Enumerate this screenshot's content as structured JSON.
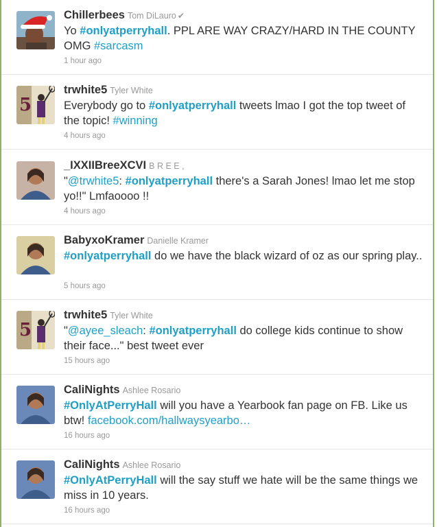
{
  "tweets": [
    {
      "screen_name": "Chillerbees",
      "full_name": "Tom DiLauro",
      "verified_mark": "✔",
      "avatar": "avatar-santa-hat-icon",
      "segments": [
        {
          "type": "text",
          "text": "Yo "
        },
        {
          "type": "tag",
          "text": "#onlyatperryhall"
        },
        {
          "type": "text",
          "text": ". PPL ARE WAY CRAZY/HARD IN THE COUNTY OMG "
        },
        {
          "type": "tag_plain",
          "text": "#sarcasm"
        }
      ],
      "time": "1 hour ago"
    },
    {
      "screen_name": "trwhite5",
      "full_name": "Tyler White",
      "avatar": "avatar-lacrosse-icon",
      "segments": [
        {
          "type": "text",
          "text": "Everybody go to "
        },
        {
          "type": "tag",
          "text": "#onlyatperryhall"
        },
        {
          "type": "text",
          "text": " tweets lmao I got the top tweet of the topic! "
        },
        {
          "type": "tag_plain",
          "text": "#winning"
        }
      ],
      "time": "4 hours ago"
    },
    {
      "screen_name": "_IXXIIBreeXCVI",
      "full_name": "B R E E ,",
      "avatar": "avatar-portrait-icon",
      "segments": [
        {
          "type": "text",
          "text": "\""
        },
        {
          "type": "mention",
          "text": "@trwhite5"
        },
        {
          "type": "text",
          "text": ": "
        },
        {
          "type": "tag",
          "text": "#onlyatperryhall"
        },
        {
          "type": "text",
          "text": " there's a Sarah Jones! lmao let me stop yo!!\" Lmfaoooo !!"
        }
      ],
      "time": "4 hours ago"
    },
    {
      "screen_name": "BabyxoKramer",
      "full_name": "Danielle Kramer",
      "avatar": "avatar-portrait-icon",
      "segments": [
        {
          "type": "tag",
          "text": "#onlyatperryhall"
        },
        {
          "type": "text",
          "text": " do we have the black wizard of oz as our spring play.."
        }
      ],
      "time": "5 hours ago"
    },
    {
      "screen_name": "trwhite5",
      "full_name": "Tyler White",
      "avatar": "avatar-lacrosse-icon",
      "segments": [
        {
          "type": "text",
          "text": "\""
        },
        {
          "type": "mention",
          "text": "@ayee_sleach"
        },
        {
          "type": "text",
          "text": ": "
        },
        {
          "type": "tag",
          "text": "#onlyatperryhall"
        },
        {
          "type": "text",
          "text": " do college kids continue to show their face...\" best tweet ever"
        }
      ],
      "time": "15 hours ago"
    },
    {
      "screen_name": "CaliNights",
      "full_name": "Ashlee Rosario",
      "avatar": "avatar-portrait-icon",
      "segments": [
        {
          "type": "tag",
          "text": "#OnlyAtPerryHall"
        },
        {
          "type": "text",
          "text": " will you have a Yearbook fan page on FB. Like us btw! "
        },
        {
          "type": "link",
          "text": "facebook.com/hallwaysyearbo…"
        }
      ],
      "time": "16 hours ago"
    },
    {
      "screen_name": "CaliNights",
      "full_name": "Ashlee Rosario",
      "avatar": "avatar-portrait-icon",
      "segments": [
        {
          "type": "tag",
          "text": "#OnlyAtPerryHall"
        },
        {
          "type": "text",
          "text": " will the say stuff we hate will be the same things we miss in 10 years."
        }
      ],
      "time": "16 hours ago"
    }
  ],
  "colors": {
    "link": "#1f9fc6",
    "text": "#333333",
    "meta": "#999999",
    "divider": "#e6e6e6",
    "frame": "#8db36a"
  }
}
